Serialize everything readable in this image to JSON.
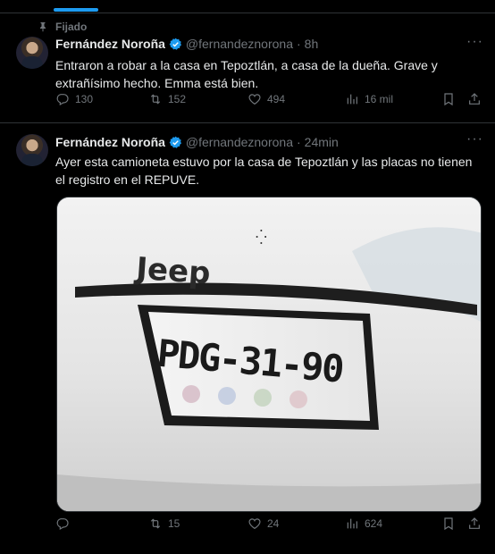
{
  "pinned_label": "Fijado",
  "tweets": [
    {
      "name": "Fernández Noroña",
      "handle": "@fernandeznorona",
      "time": "8h",
      "text": "Entraron a robar a la casa en Tepoztlán, a casa de la dueña. Grave y extrañísimo hecho. Emma está bien.",
      "replies": "130",
      "retweets": "152",
      "likes": "494",
      "views": "16 mil"
    },
    {
      "name": "Fernández Noroña",
      "handle": "@fernandeznorona",
      "time": "24min",
      "text": "Ayer esta camioneta estuvo por la casa de Tepoztlán y las placas no tienen el registro en el REPUVE.",
      "media": {
        "brand_text": "Jeep",
        "plate_text": "PDG-31-90"
      },
      "replies": "",
      "retweets": "15",
      "likes": "24",
      "views": "624"
    }
  ],
  "colors": {
    "accent": "#1d9bf0",
    "muted": "#71767b",
    "text": "#e7e9ea",
    "border": "#2f3336"
  }
}
